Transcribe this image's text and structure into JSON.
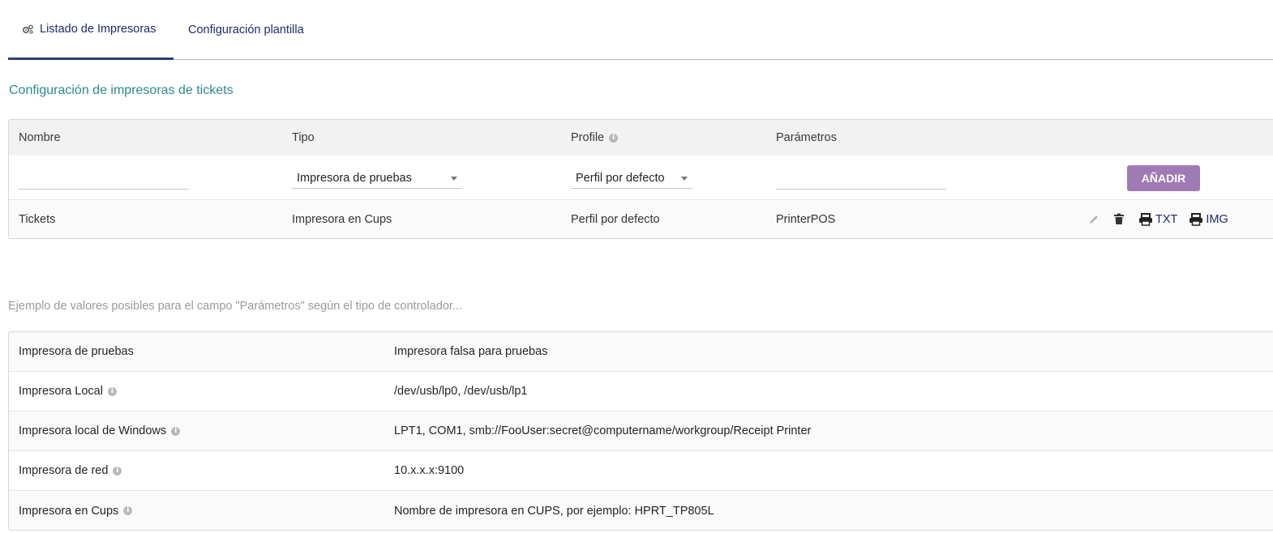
{
  "tabs": [
    {
      "label": "Listado de Impresoras",
      "icon": "gears-icon",
      "active": true
    },
    {
      "label": "Configuración plantilla",
      "active": false
    }
  ],
  "section_title": "Configuración de impresoras de tickets",
  "printer_table": {
    "headers": {
      "nombre": "Nombre",
      "tipo": "Tipo",
      "profile": "Profile",
      "parametros": "Parámetros"
    },
    "new_row": {
      "nombre_value": "",
      "tipo_selected": "Impresora de pruebas",
      "profile_selected": "Perfil por defecto",
      "parametros_value": "",
      "add_label": "AÑADIR"
    },
    "rows": [
      {
        "nombre": "Tickets",
        "tipo": "Impresora en Cups",
        "profile": "Perfil por defecto",
        "parametros": "PrinterPOS",
        "actions": {
          "txt_label": "TXT",
          "img_label": "IMG"
        }
      }
    ]
  },
  "example_note": "Ejemplo de valores posibles para el campo \"Parámetros\" según el tipo de controlador...",
  "examples": [
    {
      "name": "Impresora de pruebas",
      "info": false,
      "value": "Impresora falsa para pruebas"
    },
    {
      "name": "Impresora Local",
      "info": true,
      "value": "/dev/usb/lp0, /dev/usb/lp1"
    },
    {
      "name": "Impresora local de Windows",
      "info": true,
      "value": "LPT1, COM1, smb://FooUser:secret@computername/workgroup/Receipt Printer"
    },
    {
      "name": "Impresora de red",
      "info": true,
      "value": "10.x.x.x:9100"
    },
    {
      "name": "Impresora en Cups",
      "info": true,
      "value": "Nombre de impresora en CUPS, por ejemplo: HPRT_TP805L"
    }
  ],
  "colors": {
    "accent": "#1f2a6b",
    "title": "#2a8a8e",
    "add_button": "#a07ab5"
  }
}
